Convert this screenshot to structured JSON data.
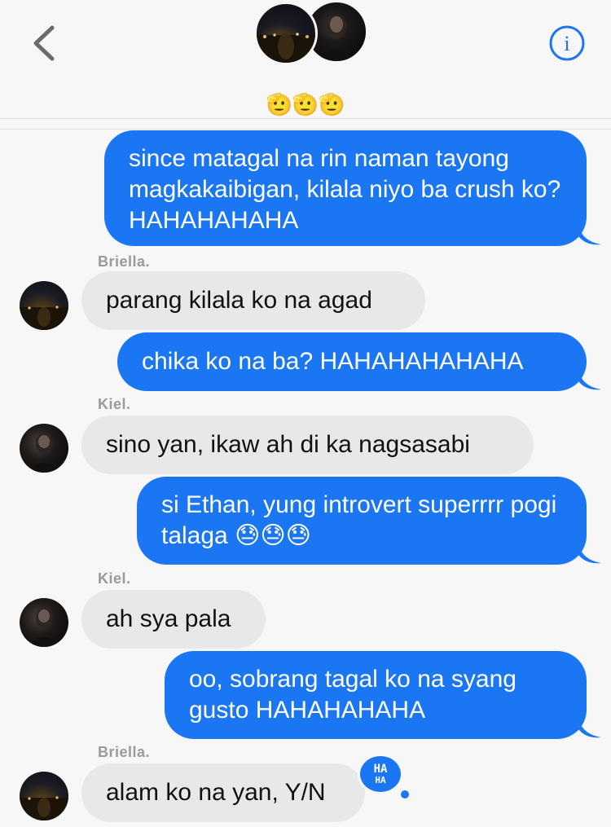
{
  "header": {
    "back_icon": "chevron-left-icon",
    "info_icon": "info-circle-icon",
    "info_label": "i",
    "group_emoji": "🫡🫡🫡"
  },
  "messages": [
    {
      "id": "m1",
      "direction": "outgoing",
      "text": "since matagal na rin naman tayong magkakaibigan, kilala niyo ba crush ko? HAHAHAHAHA"
    },
    {
      "id": "m2",
      "direction": "incoming",
      "sender": "Briella.",
      "text": "parang kilala ko na agad"
    },
    {
      "id": "m3",
      "direction": "outgoing",
      "text": "chika ko na ba? HAHAHAHAHAHA"
    },
    {
      "id": "m4",
      "direction": "incoming",
      "sender": "Kiel.",
      "text": "sino yan, ikaw ah di ka nagsasabi"
    },
    {
      "id": "m5",
      "direction": "outgoing",
      "text": "si Ethan, yung introvert superrrr pogi talaga 😓😓😓"
    },
    {
      "id": "m6",
      "direction": "incoming",
      "sender": "Kiel.",
      "text": "ah sya pala"
    },
    {
      "id": "m7",
      "direction": "outgoing",
      "text": "oo, sobrang tagal ko na syang gusto HAHAHAHAHA"
    },
    {
      "id": "m8",
      "direction": "incoming",
      "sender": "Briella.",
      "text": "alam ko na yan, Y/N",
      "reaction": {
        "line1": "HA",
        "line2": "HA"
      }
    }
  ],
  "colors": {
    "outgoing_bubble": "#1a76f2",
    "incoming_bubble": "#e8e8ea",
    "background": "#f7f7f7"
  }
}
